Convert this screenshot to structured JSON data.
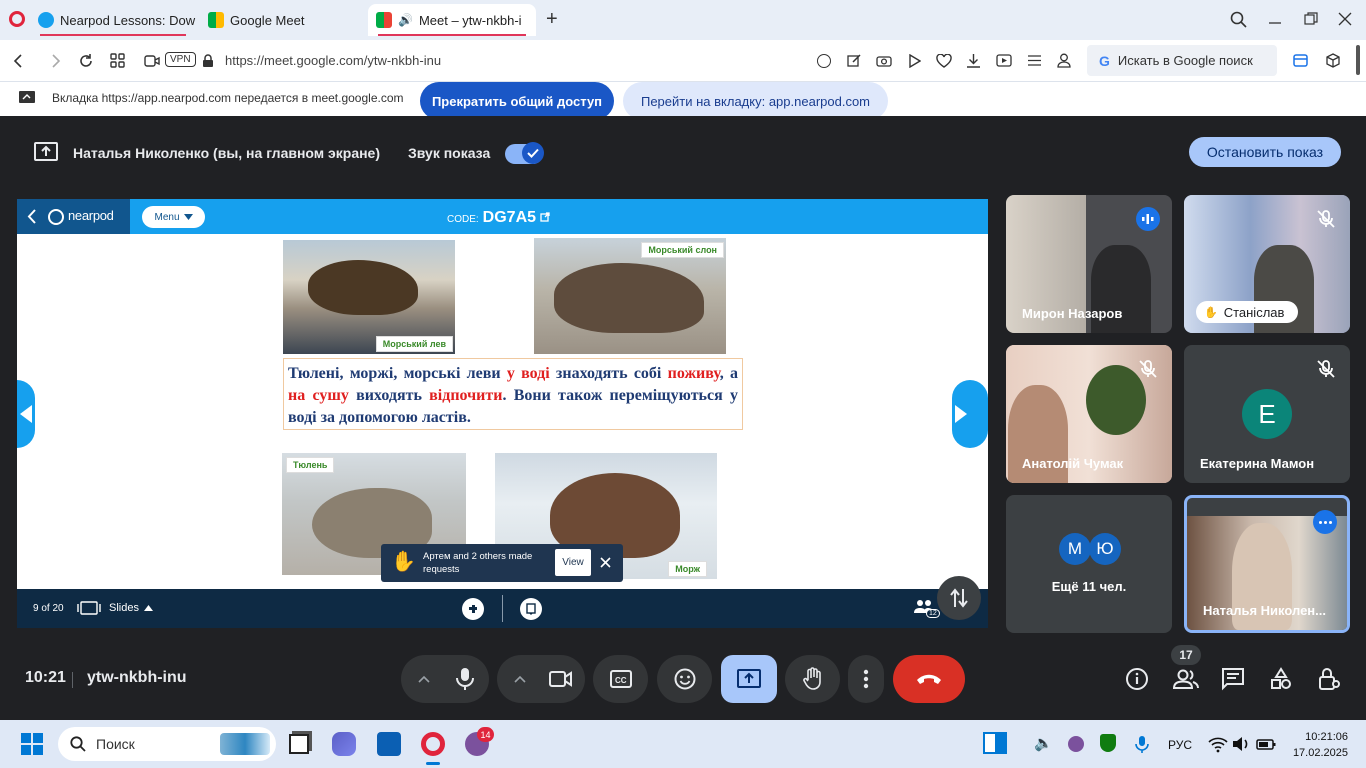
{
  "browser": {
    "tabs": [
      {
        "label": "Nearpod Lessons: Downlo"
      },
      {
        "label": "Google Meet"
      },
      {
        "label": "Meet – ytw-nkbh-i"
      }
    ],
    "vpn_label": "VPN",
    "url": "https://meet.google.com/ytw-nkbh-inu",
    "search_placeholder": "Искать в Google поиск"
  },
  "share_bar": {
    "message": "Вкладка https://app.nearpod.com передается в meet.google.com",
    "stop_label": "Прекратить общий доступ",
    "goto_label": "Перейти на вкладку: app.nearpod.com"
  },
  "presenting": {
    "presenter": "Наталья Николенко (вы, на главном экране)",
    "sound_label": "Звук показа",
    "sound_on": true,
    "stop_label": "Остановить показ"
  },
  "nearpod": {
    "logo": "nearpod",
    "menu_label": "Menu",
    "code_prefix": "CODE:",
    "code": "DG7A5",
    "slide": {
      "captions": {
        "sea_lion": "Морський лев",
        "elephant_seal": "Морський слон",
        "seal": "Тюлень",
        "walrus": "Морж"
      },
      "text_parts": [
        {
          "t": "Тюлені, моржі, морські леви ",
          "red": false
        },
        {
          "t": "у воді",
          "red": true
        },
        {
          "t": " знаходять собі ",
          "red": false
        },
        {
          "t": "поживу",
          "red": true
        },
        {
          "t": ", а ",
          "red": false
        },
        {
          "t": "на сушу",
          "red": true
        },
        {
          "t": " виходять ",
          "red": false
        },
        {
          "t": "відпочити",
          "red": true
        },
        {
          "t": ". Вони також переміщуються у воді за допомогою ластів.",
          "red": false
        }
      ]
    },
    "footer": {
      "page": "9 of 20",
      "slides_label": "Slides",
      "participants_badge": "12"
    },
    "toast": {
      "message": "Артем and 2 others made requests",
      "view_label": "View"
    }
  },
  "participants": [
    {
      "name": "Мирон Назаров",
      "speaking": true
    },
    {
      "name": "Станіслав",
      "muted": true
    },
    {
      "name": "Анатолій Чумак",
      "muted": true
    },
    {
      "name": "Екатерина Мамон",
      "initial": "Е",
      "muted": true
    },
    {
      "name": "Ещё 11 чел.",
      "initials": [
        "М",
        "Ю"
      ]
    },
    {
      "name": "Наталья Николен..."
    }
  ],
  "meet_bar": {
    "time": "10:21",
    "code": "ytw-nkbh-inu",
    "people_count": "17"
  },
  "taskbar": {
    "search_label": "Поиск",
    "badge": "14",
    "lang": "РУС",
    "time": "10:21:06",
    "date": "17.02.2025"
  },
  "colors": {
    "meet_bg": "#202124",
    "nearpod_blue": "#16a0ee",
    "nearpod_dark": "#11568e",
    "end_call": "#d93025",
    "active_btn": "#a8c7fa"
  }
}
